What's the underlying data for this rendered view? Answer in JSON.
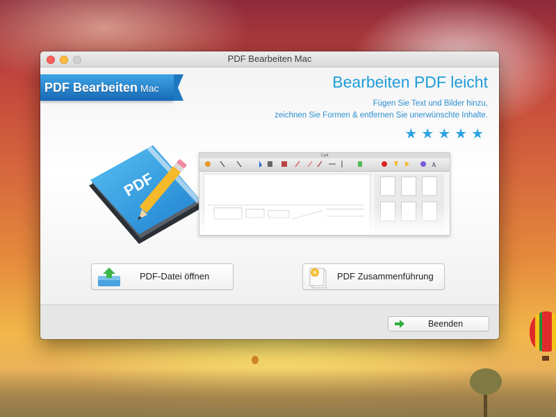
{
  "window": {
    "title": "PDF Bearbeiten Mac"
  },
  "banner": {
    "brand": "PDF Bearbeiten",
    "brand_suffix": "Mac",
    "headline": "Bearbeiten PDF leicht",
    "subline1": "Fügen Sie Text und Bilder hinzu,",
    "subline2": "zeichnen Sie Formen & entfernen Sie unerwünschte Inhalte.",
    "stars": "★★★★★",
    "accent_color": "#1e9cd8"
  },
  "hero": {
    "book_label": "PDF",
    "screenshot_title": "2.pdf",
    "screenshot_tools": [
      "Rotate",
      "Zoom in",
      "Zoom Out",
      "Select",
      "Add Text",
      "Add Image",
      "Pencil",
      "Eraser",
      "Brush",
      "H Line",
      "V Line",
      "Delete",
      "Undo",
      "Redo",
      "Color",
      "Font"
    ]
  },
  "actions": {
    "open_label": "PDF-Datei öffnen",
    "merge_label": "PDF Zusammenführung",
    "quit_label": "Beenden"
  },
  "icons": {
    "open": "open-folder-upload-icon",
    "merge": "merge-document-icon",
    "quit": "green-arrow-right-icon"
  }
}
